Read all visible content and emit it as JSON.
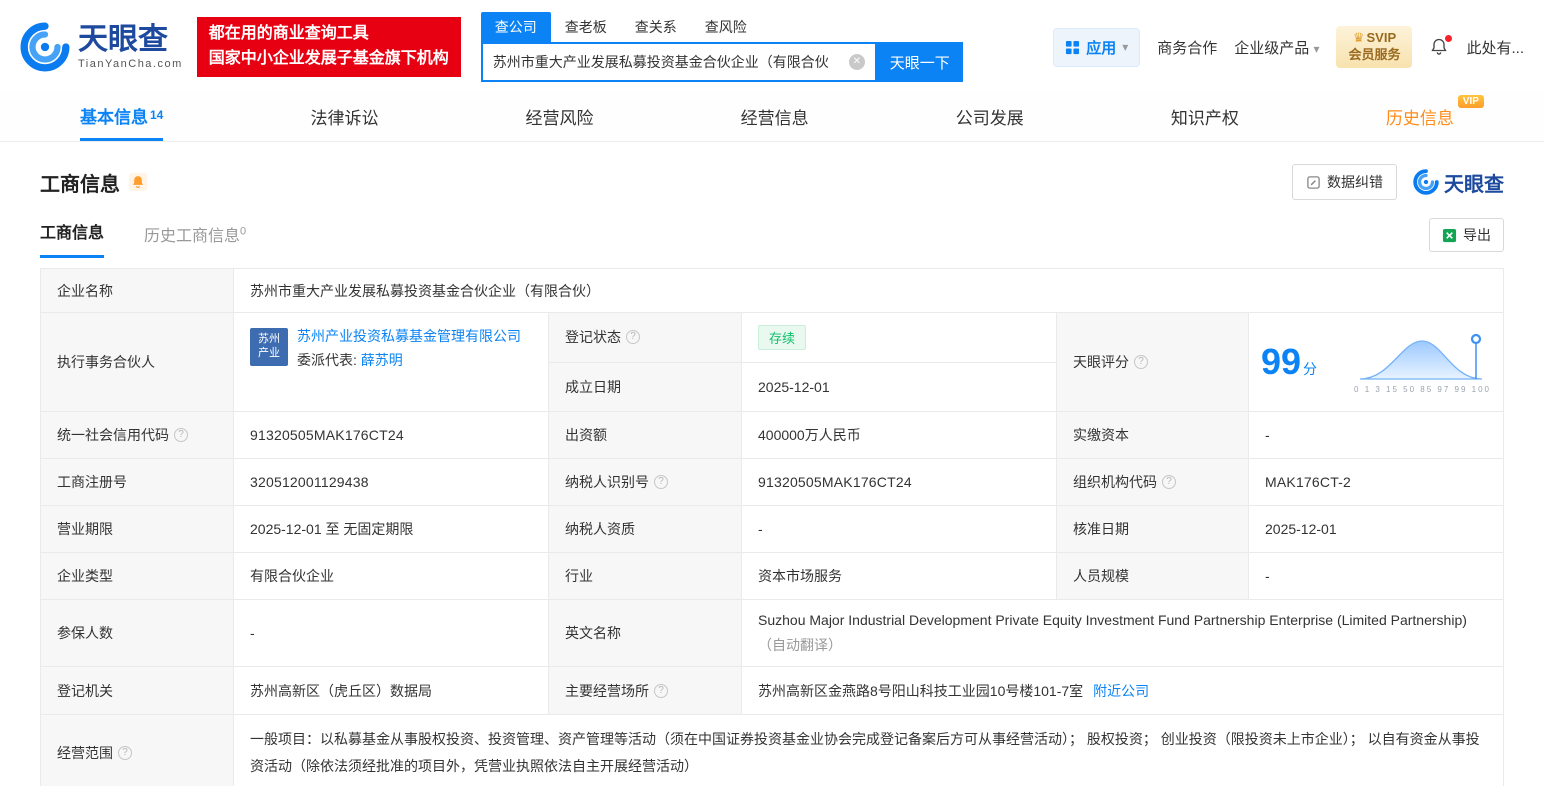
{
  "header": {
    "logo": {
      "brand": "天眼查",
      "domain": "TianYanCha.com"
    },
    "slogan": {
      "line1": "都在用的商业查询工具",
      "line2": "国家中小企业发展子基金旗下机构"
    },
    "search_tabs": [
      {
        "label": "查公司"
      },
      {
        "label": "查老板"
      },
      {
        "label": "查关系"
      },
      {
        "label": "查风险"
      }
    ],
    "search": {
      "value": "苏州市重大产业发展私募投资基金合伙企业（有限合伙",
      "button_label": "天眼一下"
    },
    "right": {
      "apps_label": "应用",
      "biz_label": "商务合作",
      "enterprise_label": "企业级产品",
      "svip_top": "SVIP",
      "svip_bottom": "会员服务",
      "more_label": "此处有..."
    }
  },
  "nav": {
    "tabs": [
      {
        "label": "基本信息",
        "count": "14"
      },
      {
        "label": "法律诉讼"
      },
      {
        "label": "经营风险"
      },
      {
        "label": "经营信息"
      },
      {
        "label": "公司发展"
      },
      {
        "label": "知识产权"
      },
      {
        "label": "历史信息",
        "badge": "VIP"
      }
    ]
  },
  "section": {
    "title": "工商信息",
    "data_correction_label": "数据纠错",
    "brand_watermark": "天眼查",
    "sub_tabs": [
      {
        "label": "工商信息"
      },
      {
        "label": "历史工商信息",
        "count": "0"
      }
    ],
    "export_label": "导出"
  },
  "table": {
    "company_name": {
      "label": "企业名称",
      "value": "苏州市重大产业发展私募投资基金合伙企业（有限合伙）"
    },
    "partner": {
      "label": "执行事务合伙人",
      "badge_line1": "苏州",
      "badge_line2": "产业",
      "company": "苏州产业投资私募基金管理有限公司",
      "delegate_label": "委派代表:",
      "delegate_name": "薛苏明"
    },
    "reg_status": {
      "label": "登记状态",
      "value": "存续"
    },
    "establish_date": {
      "label": "成立日期",
      "value": "2025-12-01"
    },
    "score": {
      "label": "天眼评分",
      "value": "99",
      "unit": "分",
      "axis": "0 1 3 15 50 85 97 99 100"
    },
    "credit_code": {
      "label": "统一社会信用代码",
      "value": "91320505MAK176CT24"
    },
    "capital": {
      "label": "出资额",
      "value": "400000万人民币"
    },
    "paid_capital": {
      "label": "实缴资本",
      "value": "-"
    },
    "reg_number": {
      "label": "工商注册号",
      "value": "320512001129438"
    },
    "taxpayer_id": {
      "label": "纳税人识别号",
      "value": "91320505MAK176CT24"
    },
    "org_code": {
      "label": "组织机构代码",
      "value": "MAK176CT-2"
    },
    "business_term": {
      "label": "营业期限",
      "value": "2025-12-01 至 无固定期限"
    },
    "taxpayer_quality": {
      "label": "纳税人资质",
      "value": "-"
    },
    "approval_date": {
      "label": "核准日期",
      "value": "2025-12-01"
    },
    "company_type": {
      "label": "企业类型",
      "value": "有限合伙企业"
    },
    "industry": {
      "label": "行业",
      "value": "资本市场服务"
    },
    "staff_size": {
      "label": "人员规模",
      "value": "-"
    },
    "insured_count": {
      "label": "参保人数",
      "value": "-"
    },
    "english_name": {
      "label": "英文名称",
      "value": "Suzhou Major Industrial Development Private Equity Investment Fund Partnership Enterprise (Limited Partnership)",
      "note": "（自动翻译）"
    },
    "reg_authority": {
      "label": "登记机关",
      "value": "苏州高新区（虎丘区）数据局"
    },
    "address": {
      "label": "主要经营场所",
      "value": "苏州高新区金燕路8号阳山科技工业园10号楼101-7室",
      "nearby_label": "附近公司"
    },
    "scope": {
      "label": "经营范围",
      "value": "一般项目：以私募基金从事股权投资、投资管理、资产管理等活动（须在中国证券投资基金业协会完成登记备案后方可从事经营活动）； 股权投资； 创业投资（限投资未上市企业）； 以自有资金从事投资活动（除依法须经批准的项目外，凭营业执照依法自主开展经营活动）"
    }
  },
  "icons": {
    "help": "?",
    "clear": "✕",
    "caret": "▾",
    "crown": "♛"
  },
  "colors": {
    "brand_blue": "#0b83f5",
    "banner_red": "#e60012",
    "status_green": "#0fbf6b",
    "vip_orange": "#ff8c19"
  }
}
